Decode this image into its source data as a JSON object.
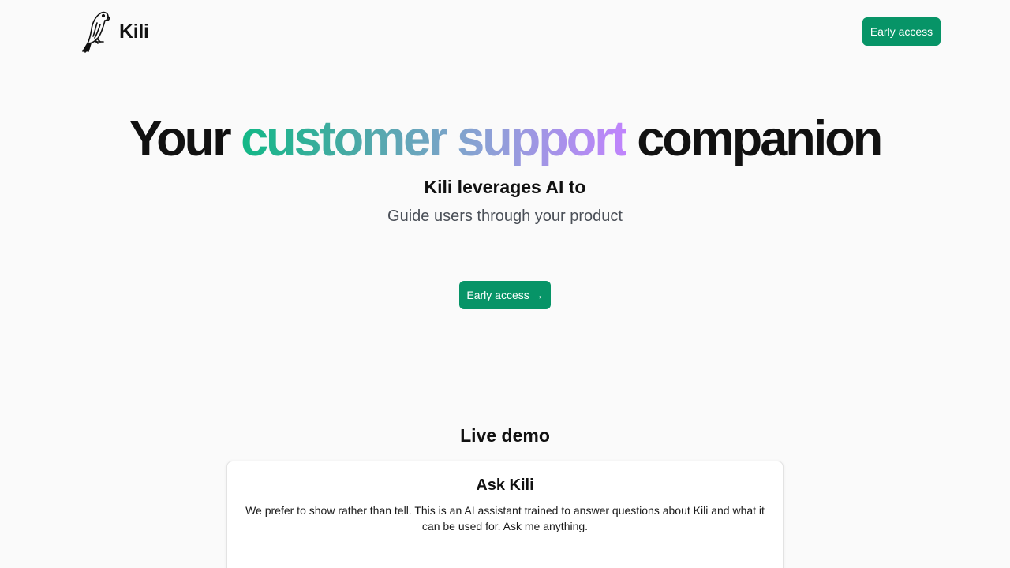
{
  "nav": {
    "brand_name": "Kili",
    "cta_label": "Early access"
  },
  "hero": {
    "title_start": "Your",
    "title_highlight": "customer support",
    "title_end": "companion",
    "subtitle": "Kili leverages AI to",
    "rotating_text": "Guide users through your product",
    "cta_label": "Early access →"
  },
  "demo": {
    "section_title": "Live demo",
    "card_title": "Ask Kili",
    "card_description": "We prefer to show rather than tell. This is an AI assistant trained to answer questions about Kili and what it can be used for. Ask me anything."
  },
  "icons": {
    "logo": "parrot-icon"
  },
  "colors": {
    "accent": "#079467",
    "background": "#fafafa",
    "gradient": [
      "#12b886",
      "#4aa9a6",
      "#8aa2d4",
      "#c084fc"
    ]
  }
}
